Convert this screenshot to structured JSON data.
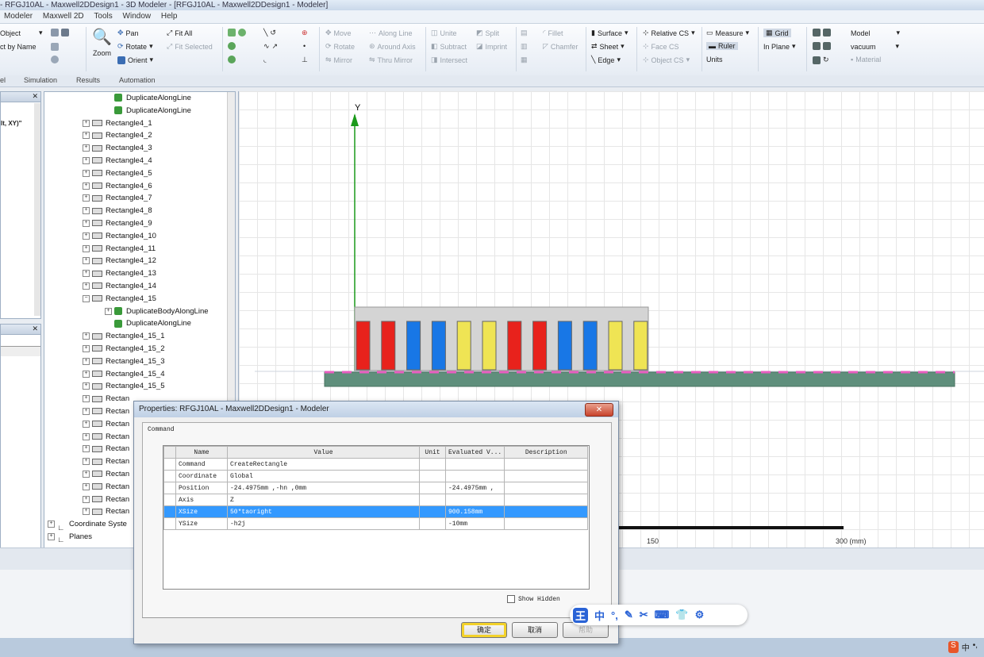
{
  "window": {
    "title": "- RFGJ10AL - Maxwell2DDesign1 - 3D Modeler - [RFGJ10AL - Maxwell2DDesign1 - Modeler]"
  },
  "menu": [
    "Modeler",
    "Maxwell 2D",
    "Tools",
    "Window",
    "Help"
  ],
  "ribbon": {
    "select_mode": "Object",
    "select_by_name": "ct by Name",
    "pan": "Pan",
    "rotate": "Rotate",
    "orient": "Orient",
    "zoom": "Zoom",
    "fit_all": "Fit All",
    "fit_selected": "Fit Selected",
    "move": "Move",
    "rotate2": "Rotate",
    "mirror": "Mirror",
    "along_line": "Along Line",
    "around_axis": "Around Axis",
    "thru_mirror": "Thru Mirror",
    "unite": "Unite",
    "subtract": "Subtract",
    "intersect": "Intersect",
    "split": "Split",
    "imprint": "Imprint",
    "fillet": "Fillet",
    "chamfer": "Chamfer",
    "surface": "Surface",
    "sheet": "Sheet",
    "edge": "Edge",
    "relative_cs": "Relative CS",
    "face_cs": "Face CS",
    "object_cs": "Object CS",
    "measure": "Measure",
    "ruler": "Ruler",
    "units": "Units",
    "grid": "Grid",
    "in_plane": "In Plane",
    "model": "Model",
    "material_value": "vacuum",
    "material": "Material"
  },
  "ribbon_tabs": [
    "el",
    "Simulation",
    "Results",
    "Automation"
  ],
  "left_panel": {
    "label": "lt, XY)\""
  },
  "tree": {
    "items": [
      {
        "label": "DuplicateAlongLine",
        "kind": "op",
        "indent": 1
      },
      {
        "label": "DuplicateAlongLine",
        "kind": "op",
        "indent": 1
      },
      {
        "label": "Rectangle4_1",
        "kind": "rect",
        "indent": 0
      },
      {
        "label": "Rectangle4_2",
        "kind": "rect",
        "indent": 0
      },
      {
        "label": "Rectangle4_3",
        "kind": "rect",
        "indent": 0
      },
      {
        "label": "Rectangle4_4",
        "kind": "rect",
        "indent": 0
      },
      {
        "label": "Rectangle4_5",
        "kind": "rect",
        "indent": 0
      },
      {
        "label": "Rectangle4_6",
        "kind": "rect",
        "indent": 0
      },
      {
        "label": "Rectangle4_7",
        "kind": "rect",
        "indent": 0
      },
      {
        "label": "Rectangle4_8",
        "kind": "rect",
        "indent": 0
      },
      {
        "label": "Rectangle4_9",
        "kind": "rect",
        "indent": 0
      },
      {
        "label": "Rectangle4_10",
        "kind": "rect",
        "indent": 0
      },
      {
        "label": "Rectangle4_11",
        "kind": "rect",
        "indent": 0
      },
      {
        "label": "Rectangle4_12",
        "kind": "rect",
        "indent": 0
      },
      {
        "label": "Rectangle4_13",
        "kind": "rect",
        "indent": 0
      },
      {
        "label": "Rectangle4_14",
        "kind": "rect",
        "indent": 0
      },
      {
        "label": "Rectangle4_15",
        "kind": "rect-open",
        "indent": 0
      },
      {
        "label": "DuplicateBodyAlongLine",
        "kind": "op",
        "indent": 1
      },
      {
        "label": "DuplicateAlongLine",
        "kind": "op",
        "indent": 1
      },
      {
        "label": "Rectangle4_15_1",
        "kind": "rect",
        "indent": 0
      },
      {
        "label": "Rectangle4_15_2",
        "kind": "rect",
        "indent": 0
      },
      {
        "label": "Rectangle4_15_3",
        "kind": "rect",
        "indent": 0
      },
      {
        "label": "Rectangle4_15_4",
        "kind": "rect",
        "indent": 0
      },
      {
        "label": "Rectangle4_15_5",
        "kind": "rect",
        "indent": 0
      },
      {
        "label": "Rectan",
        "kind": "rect",
        "indent": 0
      },
      {
        "label": "Rectan",
        "kind": "rect",
        "indent": 0
      },
      {
        "label": "Rectan",
        "kind": "rect",
        "indent": 0
      },
      {
        "label": "Rectan",
        "kind": "rect",
        "indent": 0
      },
      {
        "label": "Rectan",
        "kind": "rect",
        "indent": 0
      },
      {
        "label": "Rectan",
        "kind": "rect",
        "indent": 0
      },
      {
        "label": "Rectan",
        "kind": "rect",
        "indent": 0
      },
      {
        "label": "Rectan",
        "kind": "rect",
        "indent": 0
      },
      {
        "label": "Rectan",
        "kind": "rect",
        "indent": 0
      },
      {
        "label": "Rectan",
        "kind": "rect",
        "indent": 0
      },
      {
        "label": "Coordinate Syste",
        "kind": "folder",
        "indent": -1
      },
      {
        "label": "Planes",
        "kind": "folder",
        "indent": -1
      }
    ]
  },
  "canvas": {
    "axis_label": "Y",
    "scale_labels": [
      "150",
      "300 (mm)"
    ],
    "coil_colors": [
      "#e8221c",
      "#e8221c",
      "#1877e6",
      "#1877e6",
      "#efe454",
      "#efe454",
      "#e8221c",
      "#e8221c",
      "#1877e6",
      "#1877e6",
      "#efe454",
      "#efe454"
    ]
  },
  "dialog": {
    "title": "Properties: RFGJ10AL - Maxwell2DDesign1 - Modeler",
    "close": "✕",
    "tab": "Command",
    "columns": [
      "Name",
      "Value",
      "Unit",
      "Evaluated V...",
      "Description"
    ],
    "rows": [
      {
        "name": "Command",
        "value": "CreateRectangle",
        "unit": "",
        "evaluated": "",
        "desc": "",
        "selected": false
      },
      {
        "name": "Coordinate",
        "value": "Global",
        "unit": "",
        "evaluated": "",
        "desc": "",
        "selected": false
      },
      {
        "name": "Position",
        "value": "-24.4975mm ,-hn ,0mm",
        "unit": "",
        "evaluated": "-24.4975mm ,",
        "desc": "",
        "selected": false
      },
      {
        "name": "Axis",
        "value": "Z",
        "unit": "",
        "evaluated": "",
        "desc": "",
        "selected": false
      },
      {
        "name": "XSize",
        "value": "50*taoright",
        "unit": "",
        "evaluated": "900.158mm",
        "desc": "",
        "selected": true
      },
      {
        "name": "YSize",
        "value": "-h2j",
        "unit": "",
        "evaluated": "-10mm",
        "desc": "",
        "selected": false
      }
    ],
    "show_hidden": "Show Hidden",
    "ok": "确定",
    "cancel": "取消",
    "help": "帮助"
  },
  "ime": {
    "items": [
      "王",
      "中",
      "°,",
      "✎",
      "✂",
      "⌨",
      "👕",
      "⚙"
    ]
  },
  "taskbar": {
    "tray": [
      "S",
      "中",
      "•,"
    ]
  }
}
